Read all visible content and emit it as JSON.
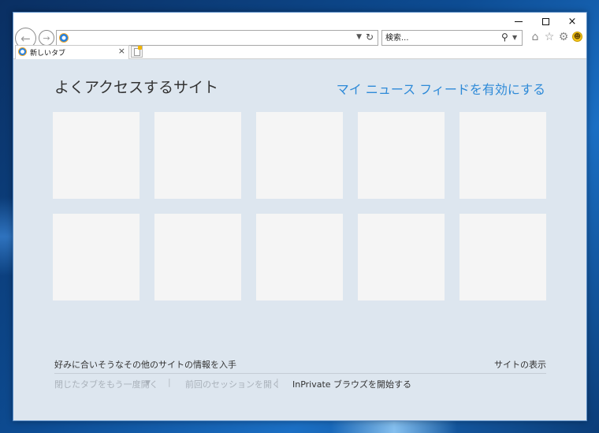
{
  "window": {
    "controls": {
      "minimize": "minimize",
      "maximize": "maximize",
      "close": "×"
    }
  },
  "toolbar": {
    "address_value": "",
    "search_placeholder": "検索..."
  },
  "tabs": [
    {
      "label": "新しいタブ",
      "close": "×"
    }
  ],
  "page": {
    "title": "よくアクセスするサイト",
    "news_feed_link": "マイ ニュース フィードを有効にする",
    "tiles_count": 10,
    "more_info": "好みに合いそうなその他のサイトの情報を入手",
    "show_sites": "サイトの表示",
    "reopen_closed_tabs": "閉じたタブをもう一度開く",
    "reopen_last_session": "前回のセッションを開く",
    "start_inprivate": "InPrivate ブラウズを開始する",
    "separator": "|"
  },
  "icons": {
    "back": "back-arrow-icon",
    "forward": "forward-arrow-icon",
    "home": "home-icon",
    "favorites": "star-icon",
    "tools": "gear-icon",
    "feedback": "smiley-icon"
  },
  "colors": {
    "content_bg": "#dde6ef",
    "link_blue": "#2e8ad8",
    "tile_bg": "#f5f5f5"
  }
}
